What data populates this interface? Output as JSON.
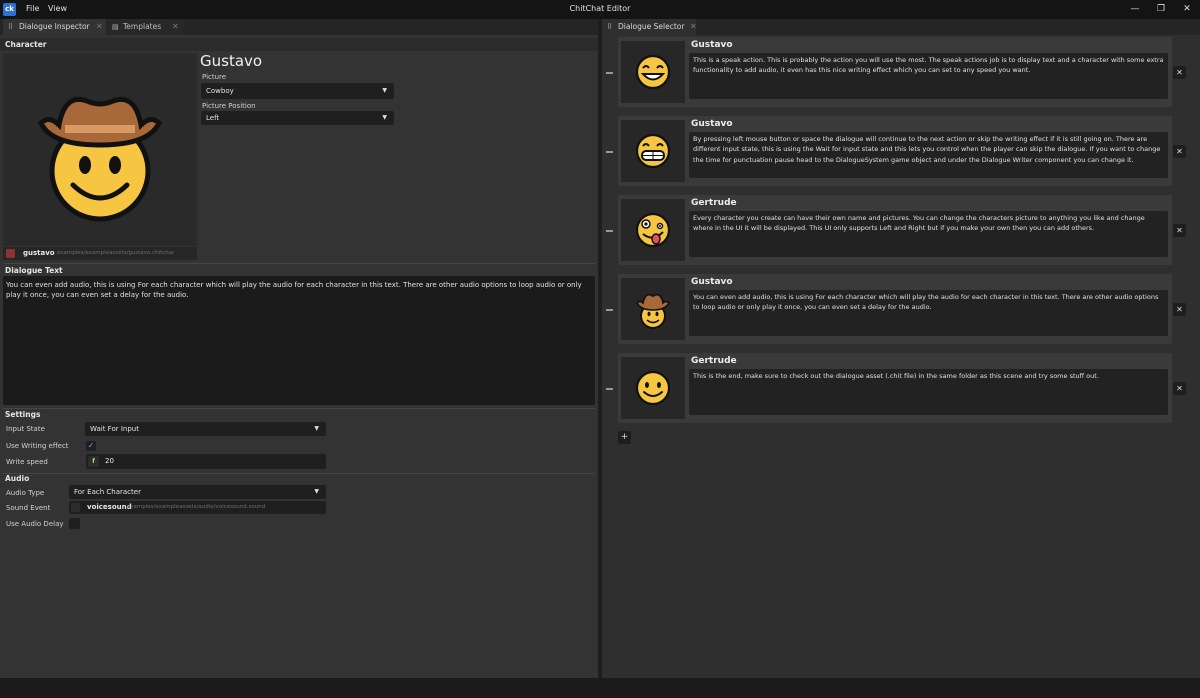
{
  "window": {
    "logo": "ck",
    "title": "ChitChat Editor",
    "menu": [
      "File",
      "View"
    ],
    "controls": {
      "minimize": "—",
      "maximize": "❐",
      "close": "✕"
    }
  },
  "left_panel": {
    "tabs": [
      {
        "label": "Dialogue Inspector",
        "icon": "grid-icon",
        "close": "✕"
      },
      {
        "label": "Templates",
        "icon": "doc-icon",
        "close": "✕"
      }
    ],
    "character": {
      "section": "Character",
      "name": "Gustavo",
      "picture_label": "Picture",
      "picture_value": "Cowboy",
      "position_label": "Picture Position",
      "position_value": "Left",
      "asset_name": "gustavo",
      "asset_path": "examples/exampleassets/gustavo.chitchar"
    },
    "dialogue_text": {
      "section": "Dialogue Text",
      "value": "You can even add audio, this is using For each character which will play the audio for each character in this text. There are other audio options to loop audio or only play it once, you can even set a delay for the audio."
    },
    "settings": {
      "section": "Settings",
      "input_state_label": "Input State",
      "input_state_value": "Wait For Input",
      "writing_effect_label": "Use Writing effect",
      "writing_effect_checked": "✓",
      "write_speed_label": "Write speed",
      "write_speed_badge": "f",
      "write_speed_value": "20"
    },
    "audio": {
      "section": "Audio",
      "audio_type_label": "Audio Type",
      "audio_type_value": "For Each Character",
      "sound_event_label": "Sound Event",
      "sound_name": "voicesound",
      "sound_path": "examples/exampleassets/audio/voicesound.sound",
      "delay_label": "Use Audio Delay"
    }
  },
  "right_panel": {
    "tabs": [
      {
        "label": "Dialogue Selector",
        "icon": "grid-icon",
        "close": "✕"
      }
    ],
    "entries": [
      {
        "name": "Gustavo",
        "emoji": "grinning",
        "text": "This is a speak action. This is probably the action you will use the most. The speak actions job is to display text and a character with some extra functionality to add audio, it even has this nice writing effect which you can set to any speed you want."
      },
      {
        "name": "Gustavo",
        "emoji": "grin",
        "text": "By pressing left mouse button or space the dialogue will continue to the next action or skip the writing effect if it is still going on. There are different input state, this is using the Wait for input state and this lets you control when the player can skip the dialogue. If you want to change the time for punctuation pause head to the DialogueSystem game object and under the Dialogue Writer component you can change it."
      },
      {
        "name": "Gertrude",
        "emoji": "zany",
        "text": "Every character you create can have their own name and pictures.  You can change the characters picture to anything you like and change where in the UI it will be displayed. This UI only supports Left and Right but if you make your own then you can add others."
      },
      {
        "name": "Gustavo",
        "emoji": "cowboy",
        "text": "You can even add audio, this is using For each character which will play the audio for each character in this text. There are other audio options to loop audio or only play it once, you can even set a delay for the audio."
      },
      {
        "name": "Gertrude",
        "emoji": "smile",
        "text": "This is the end, make sure to check out the dialogue asset (.chit file) in the same folder as this scene and try some stuff out."
      }
    ],
    "remove_label": "✕",
    "add_label": "+"
  },
  "colors": {
    "accent": "#2f6fd8",
    "emoji_yellow": "#f6c542",
    "hat_brown": "#a9683a"
  }
}
